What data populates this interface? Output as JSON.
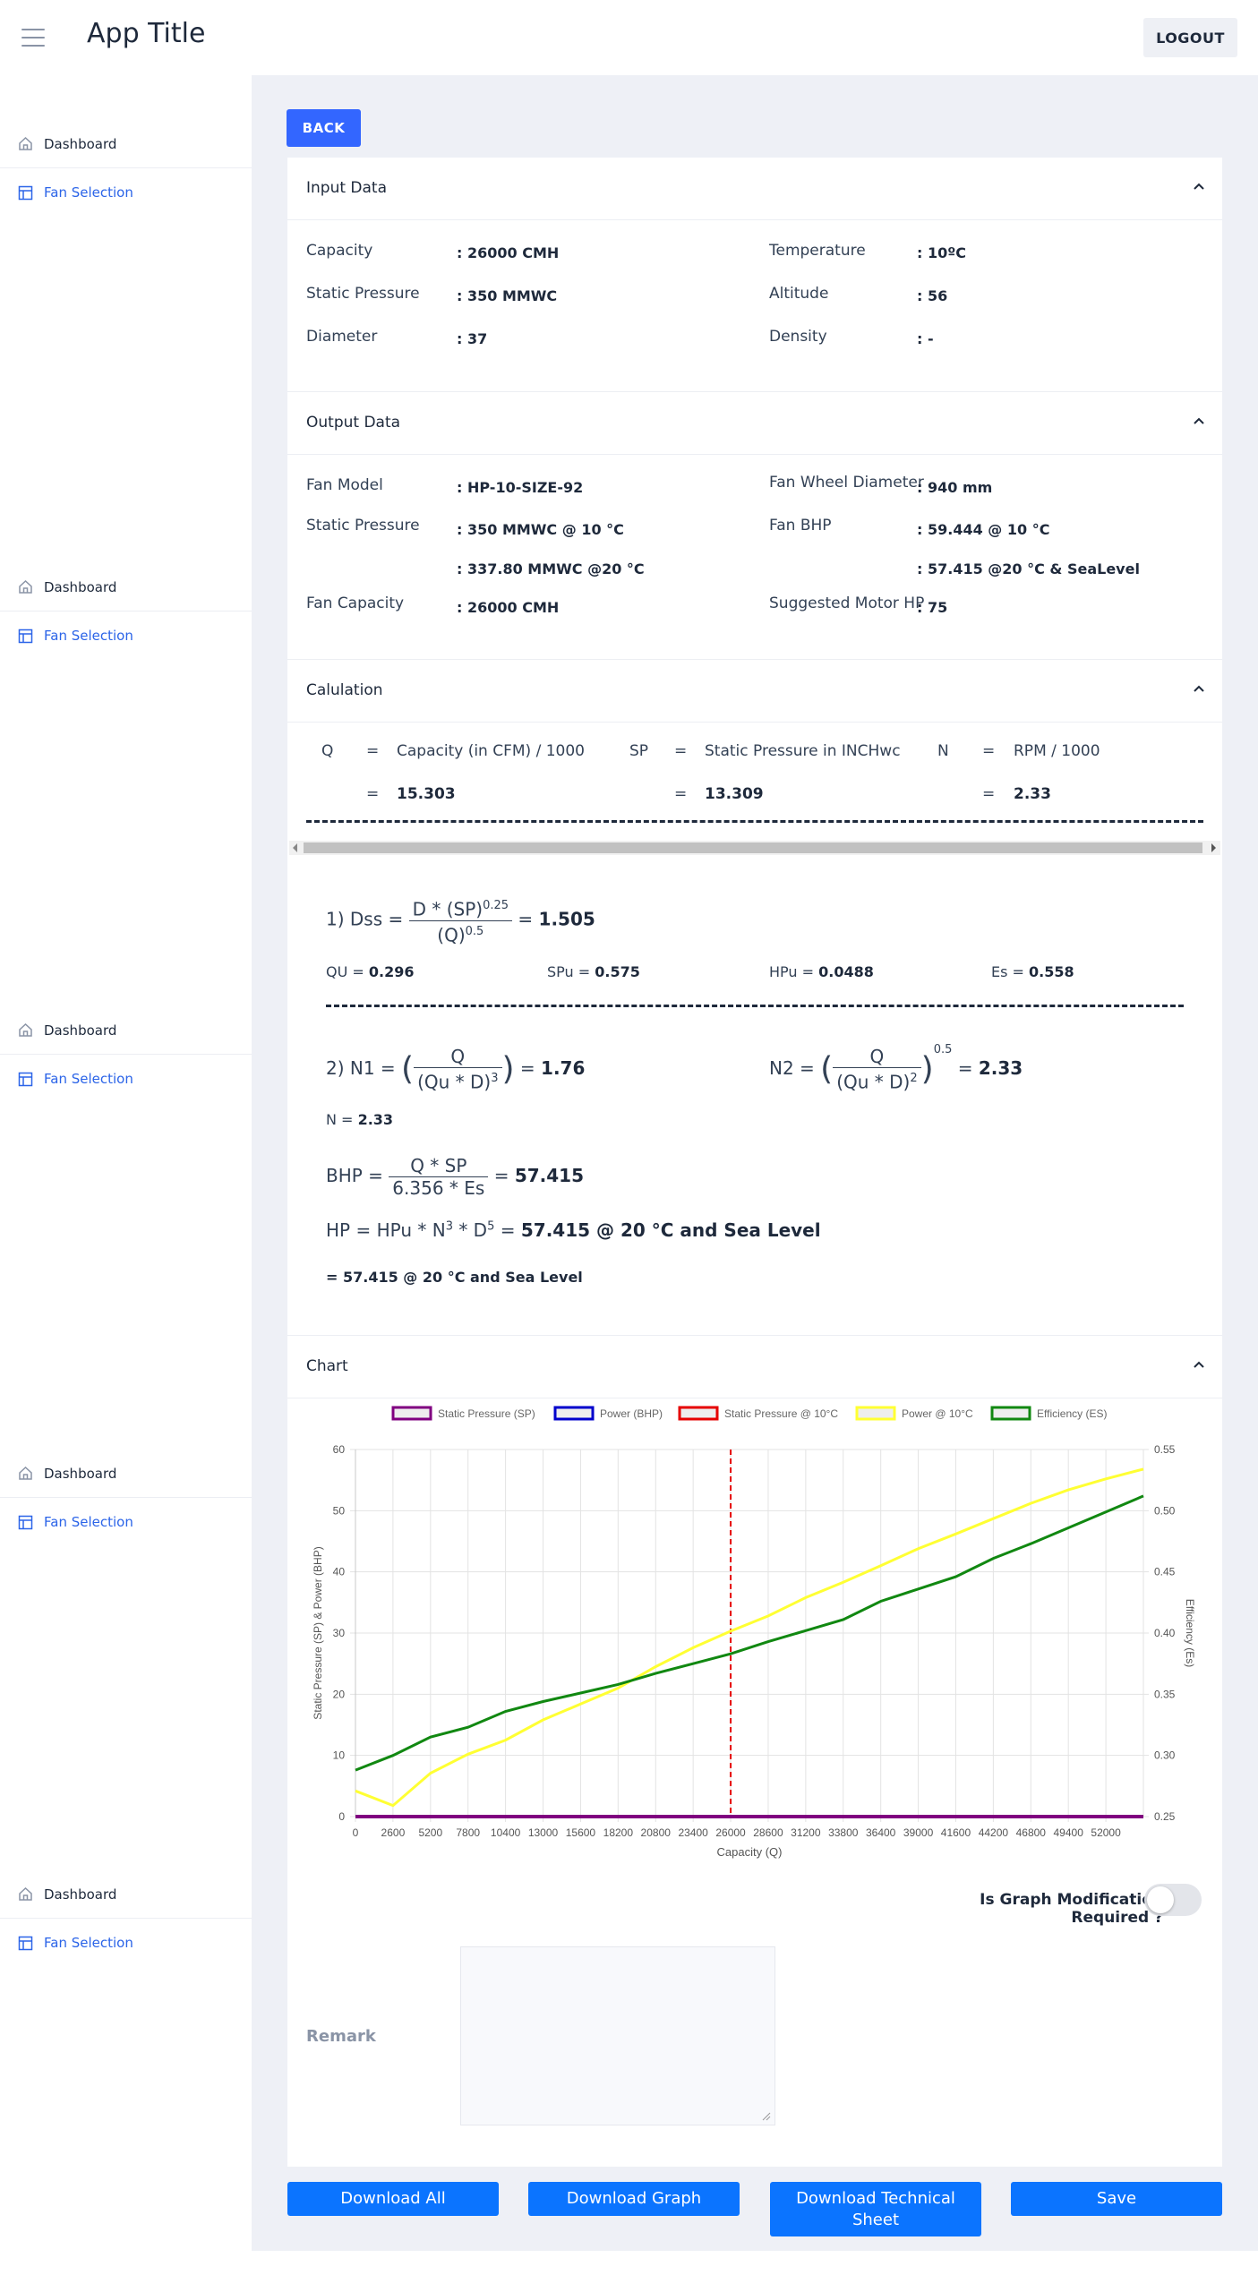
{
  "app": {
    "title": "App Title",
    "logout_label": "LOGOUT"
  },
  "sidebar": {
    "groups": [
      {
        "items": [
          {
            "label": "Dashboard",
            "icon": "home-icon"
          },
          {
            "label": "Fan Selection",
            "icon": "table-icon",
            "active": true
          }
        ]
      },
      {
        "items": [
          {
            "label": "Dashboard",
            "icon": "home-icon"
          },
          {
            "label": "Fan Selection",
            "icon": "table-icon",
            "active": true
          }
        ]
      },
      {
        "items": [
          {
            "label": "Dashboard",
            "icon": "home-icon"
          },
          {
            "label": "Fan Selection",
            "icon": "table-icon",
            "active": true
          }
        ]
      },
      {
        "items": [
          {
            "label": "Dashboard",
            "icon": "home-icon"
          },
          {
            "label": "Fan Selection",
            "icon": "table-icon",
            "active": true
          }
        ]
      },
      {
        "items": [
          {
            "label": "Dashboard",
            "icon": "home-icon"
          },
          {
            "label": "Fan Selection",
            "icon": "table-icon",
            "active": true
          }
        ]
      }
    ]
  },
  "back_label": "BACK",
  "input": {
    "title": "Input Data",
    "capacity": {
      "label": "Capacity",
      "value": ": 26000 CMH"
    },
    "static_pressure": {
      "label": "Static Pressure",
      "value": ": 350 MMWC"
    },
    "diameter": {
      "label": "Diameter",
      "value": ": 37"
    },
    "temperature": {
      "label": "Temperature",
      "value": ": 10ºC"
    },
    "altitude": {
      "label": "Altitude",
      "value": ": 56"
    },
    "density": {
      "label": "Density",
      "value": ": -"
    }
  },
  "output": {
    "title": "Output Data",
    "fan_model": {
      "label": "Fan Model",
      "value": ": HP-10-SIZE-92"
    },
    "static_pressure": {
      "label": "Static Pressure",
      "value": ": 350 MMWC @ 10 °C",
      "value2": ": 337.80 MMWC @20 °C"
    },
    "fan_capacity": {
      "label": "Fan Capacity",
      "value": ": 26000 CMH"
    },
    "fan_wheel_diameter": {
      "label": "Fan Wheel Diameter",
      "value": ": 940 mm"
    },
    "fan_bhp": {
      "label": "Fan BHP",
      "value": ": 59.444 @ 10 °C",
      "value2": ": 57.415 @20 °C & SeaLevel"
    },
    "suggested_motor_hp": {
      "label": "Suggested Motor HP",
      "value": ": 75"
    }
  },
  "calculation": {
    "title": "Calulation",
    "q_sym": "Q",
    "sp_sym": "SP",
    "n_sym": "N",
    "eq": "=",
    "q_desc": "Capacity (in CFM) / 1000",
    "sp_desc": "Static Pressure in INCHwc",
    "n_desc": "RPM / 1000",
    "q_val": "15.303",
    "sp_val": "13.309",
    "n_val": "2.33"
  },
  "formulas": {
    "dss_prefix": "1) Dss =",
    "dss_num": "D * (SP)",
    "dss_num_exp": "0.25",
    "dss_den": "(Q)",
    "dss_den_exp": "0.5",
    "dss_eq": "=",
    "dss_val": "1.505",
    "qu_label": "QU =",
    "qu_val": "0.296",
    "spu_label": "SPu =",
    "spu_val": "0.575",
    "hpu_label": "HPu =",
    "hpu_val": "0.0488",
    "es_label": "Es =",
    "es_val": "0.558",
    "n1_prefix": "2) N1 =",
    "n1_num": "Q",
    "n1_den": "(Qu * D)",
    "n1_den_exp": "3",
    "n1_eq": "=",
    "n1_val": "1.76",
    "n2_prefix": "N2 =",
    "n2_num": "Q",
    "n2_den": "(Qu * D)",
    "n2_den_exp": "2",
    "n2_exp": "0.5",
    "n2_eq": "=",
    "n2_val": "2.33",
    "n_label": "N =",
    "n_val": "2.33",
    "bhp_prefix": "BHP =",
    "bhp_num": "Q * SP",
    "bhp_den": "6.356 * Es",
    "bhp_eq": "=",
    "bhp_val": "57.415",
    "hp_prefix": "HP =",
    "hp_a": "HPu * N",
    "hp_a_exp": "3",
    "hp_b": " * D",
    "hp_b_exp": "5",
    "hp_eq": "=",
    "hp_val": "57.415 @ 20 °C and Sea Level",
    "hp_line2": "= 57.415 @ 20 °C and Sea Level"
  },
  "chart_section": {
    "title": "Chart"
  },
  "chart_data": {
    "type": "line",
    "legend": [
      "Static Pressure (SP)",
      "Power (BHP)",
      "Static Pressure @ 10°C",
      "Power @ 10°C",
      "Efficiency (ES)"
    ],
    "xlabel": "Capacity (Q)",
    "ylabel_left": "Static Pressure (SP) & Power (BHP)",
    "ylabel_right": "Efficiency (Es)",
    "x_ticks": [
      0,
      2600,
      5200,
      7800,
      10400,
      13000,
      15600,
      18200,
      20800,
      23400,
      26000,
      28600,
      31200,
      33800,
      36400,
      39000,
      41600,
      44200,
      46800,
      49400,
      52000
    ],
    "y_left_ticks": [
      0,
      10,
      20,
      30,
      40,
      50,
      60
    ],
    "y_right_ticks": [
      0.25,
      0.3,
      0.35,
      0.4,
      0.45,
      0.5,
      0.55
    ],
    "xlim": [
      0,
      54600
    ],
    "ylim_left": [
      0,
      60
    ],
    "ylim_right": [
      0.25,
      0.55
    ],
    "grid": true,
    "legend_position": "top",
    "colors": {
      "sp": "#800080",
      "bhp": "#0000cc",
      "sp10": "#e60000",
      "power10": "#ffff33",
      "es": "#118811"
    },
    "marker_x": 26000,
    "series": [
      {
        "name": "Static Pressure (SP)",
        "x": [
          0,
          54600
        ],
        "values": [
          0,
          0
        ]
      },
      {
        "name": "Power @ 10°C",
        "x": [
          0,
          2600,
          5200,
          7800,
          10400,
          13000,
          15600,
          18200,
          20800,
          23400,
          26000,
          28600,
          31200,
          33800,
          36400,
          39000,
          41600,
          44200,
          46800,
          49400,
          52000,
          54600
        ],
        "values": [
          4.2,
          1.8,
          7.1,
          10.2,
          12.5,
          15.8,
          18.4,
          21,
          24.5,
          27.6,
          30.3,
          32.8,
          35.8,
          38.3,
          41,
          43.8,
          46.2,
          48.7,
          51.2,
          53.4,
          55.2,
          56.8
        ]
      },
      {
        "name": "Efficiency (ES)",
        "x": [
          0,
          2600,
          5200,
          7800,
          10400,
          13000,
          15600,
          18200,
          20800,
          23400,
          26000,
          28600,
          31200,
          33800,
          36400,
          39000,
          41600,
          44200,
          46800,
          49400,
          52000,
          54600
        ],
        "values": [
          0.288,
          0.3,
          0.315,
          0.323,
          0.336,
          0.344,
          0.351,
          0.358,
          0.367,
          0.375,
          0.383,
          0.393,
          0.402,
          0.411,
          0.426,
          0.436,
          0.446,
          0.461,
          0.473,
          0.486,
          0.499,
          0.512
        ]
      }
    ]
  },
  "graph_modification": {
    "label": "Is Graph Modification Required ?",
    "enabled": false
  },
  "remark": {
    "label": "Remark",
    "value": ""
  },
  "buttons": {
    "download_all": "Download All",
    "download_graph": "Download Graph",
    "download_tech_1": "Download Technical",
    "download_tech_2": "Sheet",
    "save": "Save"
  }
}
